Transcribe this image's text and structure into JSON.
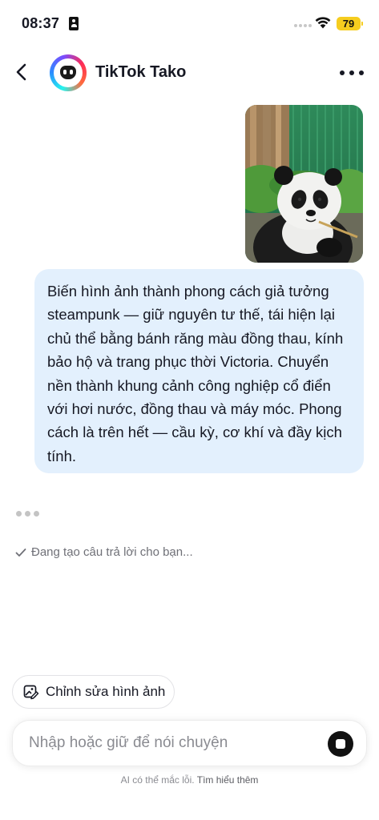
{
  "status_bar": {
    "time": "08:37",
    "battery": "79",
    "battery_color": "#f6cd1f"
  },
  "header": {
    "title": "TikTok Tako",
    "back_icon": "chevron-left-icon",
    "more_icon": "ellipsis-horizontal-icon"
  },
  "conversation": {
    "user_image": {
      "subject": "panda-photo"
    },
    "user_message": "Biến hình ảnh thành phong cách giả tưởng steampunk — giữ nguyên tư thế, tái hiện lại chủ thể bằng bánh răng màu đồng thau, kính bảo hộ và trang phục thời Victoria. Chuyển nền thành khung cảnh công nghiệp cổ điển với hơi nước, đồng thau và máy móc. Phong cách là trên hết — cầu kỳ, cơ khí và đầy kịch tính.",
    "bubble_color": "#e3f0fd",
    "status_text": "Đang tạo câu trả lời cho bạn..."
  },
  "actions": {
    "edit_image_label": "Chỉnh sửa hình ảnh"
  },
  "composer": {
    "placeholder": "Nhập hoặc giữ để nói chuyện",
    "value": ""
  },
  "footer": {
    "disclaimer": "AI có thể mắc lỗi.",
    "learn_more": "Tìm hiểu thêm"
  }
}
